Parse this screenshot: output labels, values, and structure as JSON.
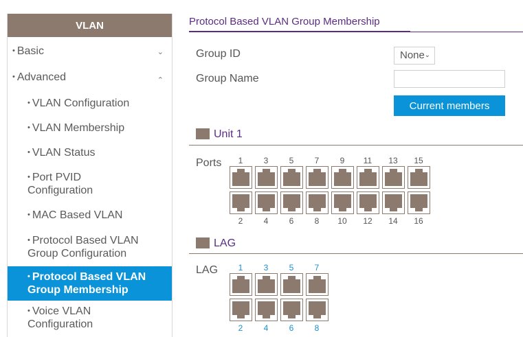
{
  "sidebar": {
    "header": "VLAN",
    "basic": "Basic",
    "advanced": "Advanced",
    "items": [
      "VLAN Configuration",
      "VLAN Membership",
      "VLAN Status",
      [
        "Port PVID",
        "Configuration"
      ],
      "MAC Based VLAN",
      [
        "Protocol Based VLAN",
        "Group Configuration"
      ],
      [
        "Protocol Based VLAN",
        "Group Membership"
      ],
      [
        "Voice VLAN",
        "Configuration"
      ]
    ]
  },
  "main": {
    "title": "Protocol Based VLAN Group Membership",
    "group_id_label": "Group ID",
    "group_id_value": "None",
    "group_name_label": "Group Name",
    "group_name_value": "",
    "current_members_button": "Current members",
    "unit_title": "Unit 1",
    "ports_label": "Ports",
    "ports_top": [
      "1",
      "3",
      "5",
      "7",
      "9",
      "11",
      "13",
      "15"
    ],
    "ports_bottom": [
      "2",
      "4",
      "6",
      "8",
      "10",
      "12",
      "14",
      "16"
    ],
    "lag_title": "LAG",
    "lag_label": "LAG",
    "lag_top": [
      "1",
      "3",
      "5",
      "7"
    ],
    "lag_bottom": [
      "2",
      "4",
      "6",
      "8"
    ]
  },
  "icons": {
    "basic_chevron": "chevron-down-icon",
    "advanced_chevron": "chevron-up-icon",
    "select_caret": "caret-down-icon"
  },
  "colors": {
    "brand_brown": "#8c7a6e",
    "accent_blue": "#0a93d8",
    "title_purple": "#5a2d82"
  }
}
